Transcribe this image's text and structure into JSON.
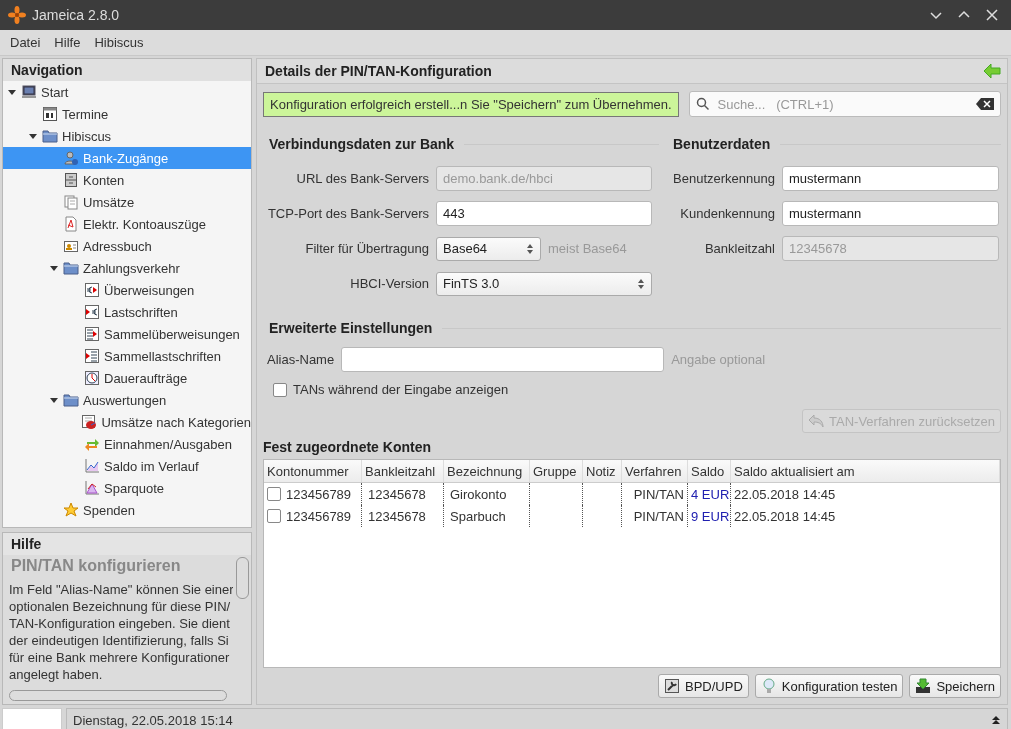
{
  "window": {
    "title": "Jameica 2.8.0"
  },
  "menu": [
    "Datei",
    "Hilfe",
    "Hibiscus"
  ],
  "navigation": {
    "title": "Navigation",
    "items": [
      {
        "label": "Start",
        "selected": false,
        "expanded": true,
        "children": [
          {
            "label": "Termine",
            "selected": false
          },
          {
            "label": "Hibiscus",
            "selected": false,
            "expanded": true,
            "children": [
              {
                "label": "Bank-Zugänge",
                "selected": true
              },
              {
                "label": "Konten",
                "selected": false
              },
              {
                "label": "Umsätze",
                "selected": false
              },
              {
                "label": "Elektr. Kontoauszüge",
                "selected": false
              },
              {
                "label": "Adressbuch",
                "selected": false
              },
              {
                "label": "Zahlungsverkehr",
                "selected": false,
                "expanded": true,
                "children": [
                  {
                    "label": "Überweisungen",
                    "selected": false
                  },
                  {
                    "label": "Lastschriften",
                    "selected": false
                  },
                  {
                    "label": "Sammelüberweisungen",
                    "selected": false
                  },
                  {
                    "label": "Sammellastschriften",
                    "selected": false
                  },
                  {
                    "label": "Daueraufträge",
                    "selected": false
                  }
                ]
              },
              {
                "label": "Auswertungen",
                "selected": false,
                "expanded": true,
                "children": [
                  {
                    "label": "Umsätze nach Kategorien",
                    "selected": false
                  },
                  {
                    "label": "Einnahmen/Ausgaben",
                    "selected": false
                  },
                  {
                    "label": "Saldo im Verlauf",
                    "selected": false
                  },
                  {
                    "label": "Sparquote",
                    "selected": false
                  }
                ]
              },
              {
                "label": "Spenden",
                "selected": false
              }
            ]
          }
        ]
      }
    ]
  },
  "help": {
    "title": "Hilfe",
    "heading": "PIN/TAN konfigurieren",
    "lines": [
      " Im Feld \"Alias-Name\" können Sie einer",
      "optionalen Bezeichnung für diese PIN/",
      "TAN-Konfiguration eingeben. Sie dient",
      "der eindeutigen Identifizierung, falls Si",
      "für eine Bank mehrere Konfigurationer",
      "angelegt haben."
    ]
  },
  "details": {
    "title": "Details der PIN/TAN-Konfiguration",
    "message": "Konfiguration erfolgreich erstell...n Sie \"Speichern\" zum Übernehmen.",
    "search": {
      "placeholder": "Suche...   (CTRL+1)"
    },
    "sections": [
      {
        "title": "Verbindungsdaten zur Bank",
        "fields": [
          {
            "kind": "text",
            "label": "URL des Bank-Servers",
            "value": "demo.bank.de/hbci",
            "disabled": true
          },
          {
            "kind": "text",
            "label": "TCP-Port des Bank-Servers",
            "value": "443",
            "disabled": false
          },
          {
            "kind": "select",
            "label": "Filter für Übertragung",
            "value": "Base64",
            "hint": "meist Base64"
          },
          {
            "kind": "select",
            "label": "HBCI-Version",
            "value": "FinTS 3.0"
          }
        ]
      },
      {
        "title": "Benutzerdaten",
        "fields": [
          {
            "kind": "text",
            "label": "Benutzerkennung",
            "value": "mustermann",
            "disabled": false
          },
          {
            "kind": "text",
            "label": "Kundenkennung",
            "value": "mustermann",
            "disabled": false
          },
          {
            "kind": "text",
            "label": "Bankleitzahl",
            "value": "12345678",
            "disabled": true
          }
        ]
      }
    ],
    "advanced": {
      "title": "Erweiterte Einstellungen",
      "alias": {
        "label": "Alias-Name",
        "hint": "Angabe optional"
      },
      "show_tans": {
        "label": "TANs während der Eingabe anzeigen",
        "checked": false
      },
      "reset_button": {
        "label": "TAN-Verfahren zurücksetzen",
        "disabled": true
      }
    },
    "accounts": {
      "title": "Fest zugeordnete Konten",
      "columns": [
        "Kontonummer",
        "Bankleitzahl",
        "Bezeichnung",
        "Gruppe",
        "Notiz",
        "Verfahren",
        "Saldo",
        "Saldo aktualisiert am"
      ],
      "rows": [
        {
          "checked": false,
          "cells": [
            "123456789",
            "12345678",
            "Girokonto",
            "",
            "",
            "PIN/TAN",
            "4 EUR",
            "22.05.2018 14:45"
          ]
        },
        {
          "checked": false,
          "cells": [
            "123456789",
            "12345678",
            "Sparbuch",
            "",
            "",
            "PIN/TAN",
            "9 EUR",
            "22.05.2018 14:45"
          ]
        }
      ]
    },
    "buttons": [
      "BPD/UPD",
      "Konfiguration testen",
      "Speichern"
    ]
  },
  "status_bar": {
    "text": "Dienstag, 22.05.2018 15:14"
  }
}
